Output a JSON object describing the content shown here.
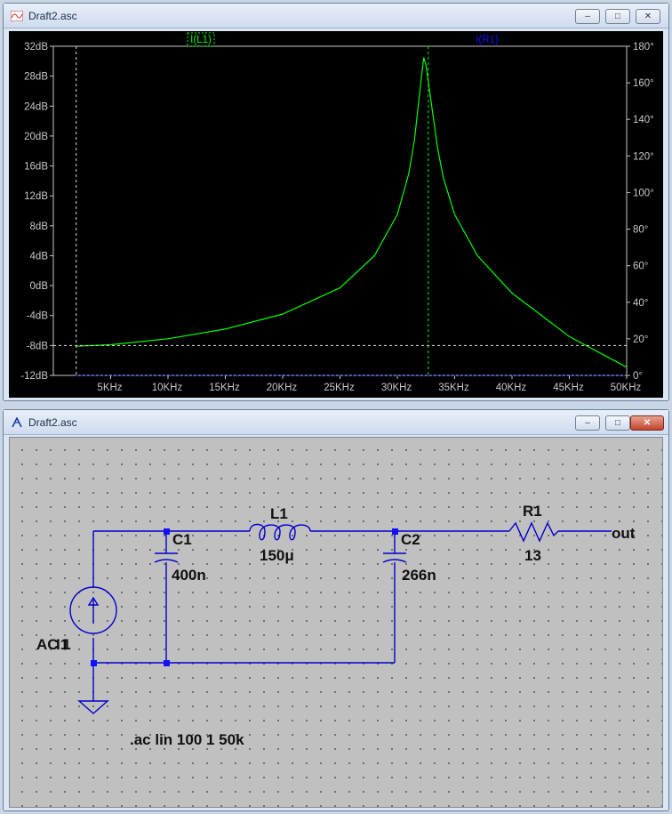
{
  "plot_window": {
    "title": "Draft2.asc",
    "minimize": "–",
    "maximize": "□",
    "close": "✕"
  },
  "schematic_window": {
    "title": "Draft2.asc",
    "minimize": "–",
    "maximize": "□",
    "close": "✕"
  },
  "colors": {
    "trace_l1": "#00ff00",
    "trace_r1": "#1010ff",
    "wire": "#0000cc",
    "label": "#101010",
    "axis": "#c8c8c8"
  },
  "chart_data": {
    "type": "line",
    "xlabel": "",
    "ylabel": "",
    "xlim": [
      1,
      50000
    ],
    "ylim": [
      -12,
      32
    ],
    "y2lim": [
      0,
      180
    ],
    "x_ticks": [
      5000,
      10000,
      15000,
      20000,
      25000,
      30000,
      35000,
      40000,
      45000,
      50000
    ],
    "x_tick_labels": [
      "5KHz",
      "10KHz",
      "15KHz",
      "20KHz",
      "25KHz",
      "30KHz",
      "35KHz",
      "40KHz",
      "45KHz",
      "50KHz"
    ],
    "y_ticks": [
      32,
      28,
      24,
      20,
      16,
      12,
      8,
      4,
      0,
      -4,
      -8,
      -12
    ],
    "y_tick_labels": [
      "32dB",
      "28dB",
      "24dB",
      "20dB",
      "16dB",
      "12dB",
      "8dB",
      "4dB",
      "0dB",
      "-4dB",
      "-8dB",
      "-12dB"
    ],
    "y2_ticks": [
      180,
      160,
      140,
      120,
      100,
      80,
      60,
      40,
      20,
      0
    ],
    "y2_tick_labels": [
      "180°",
      "160°",
      "140°",
      "120°",
      "100°",
      "80°",
      "60°",
      "40°",
      "20°",
      "0°"
    ],
    "legend": [
      "I(L1)",
      "I(R1)"
    ],
    "series": [
      {
        "name": "I(L1)",
        "x": [
          2000,
          5000,
          10000,
          15000,
          20000,
          25000,
          28000,
          30000,
          31000,
          31500,
          32000,
          32300,
          32500,
          33000,
          33500,
          34000,
          35000,
          37000,
          40000,
          45000,
          50000
        ],
        "values": [
          -8.1,
          -7.9,
          -7.1,
          -5.8,
          -3.8,
          -0.3,
          4.0,
          9.5,
          15.0,
          19.5,
          26.5,
          30.5,
          29.5,
          24.0,
          18.5,
          14.5,
          9.5,
          4.0,
          -1.0,
          -6.8,
          -10.9
        ]
      },
      {
        "name": "I(R1)",
        "x": [
          2000,
          50000
        ],
        "values": [
          -12,
          -12
        ]
      }
    ],
    "cursors": {
      "vertical_x": [
        2000,
        32700
      ],
      "horizontal_y": [
        -8
      ]
    }
  },
  "schematic": {
    "v_source": "AC 1",
    "v_source_ref": "I1",
    "c1_ref": "C1",
    "c1_val": "400n",
    "l1_ref": "L1",
    "l1_val": "150μ",
    "c2_ref": "C2",
    "c2_val": "266n",
    "r1_ref": "R1",
    "r1_val": "13",
    "net_out": "out",
    "directive": ".ac lin 100 1 50k"
  }
}
